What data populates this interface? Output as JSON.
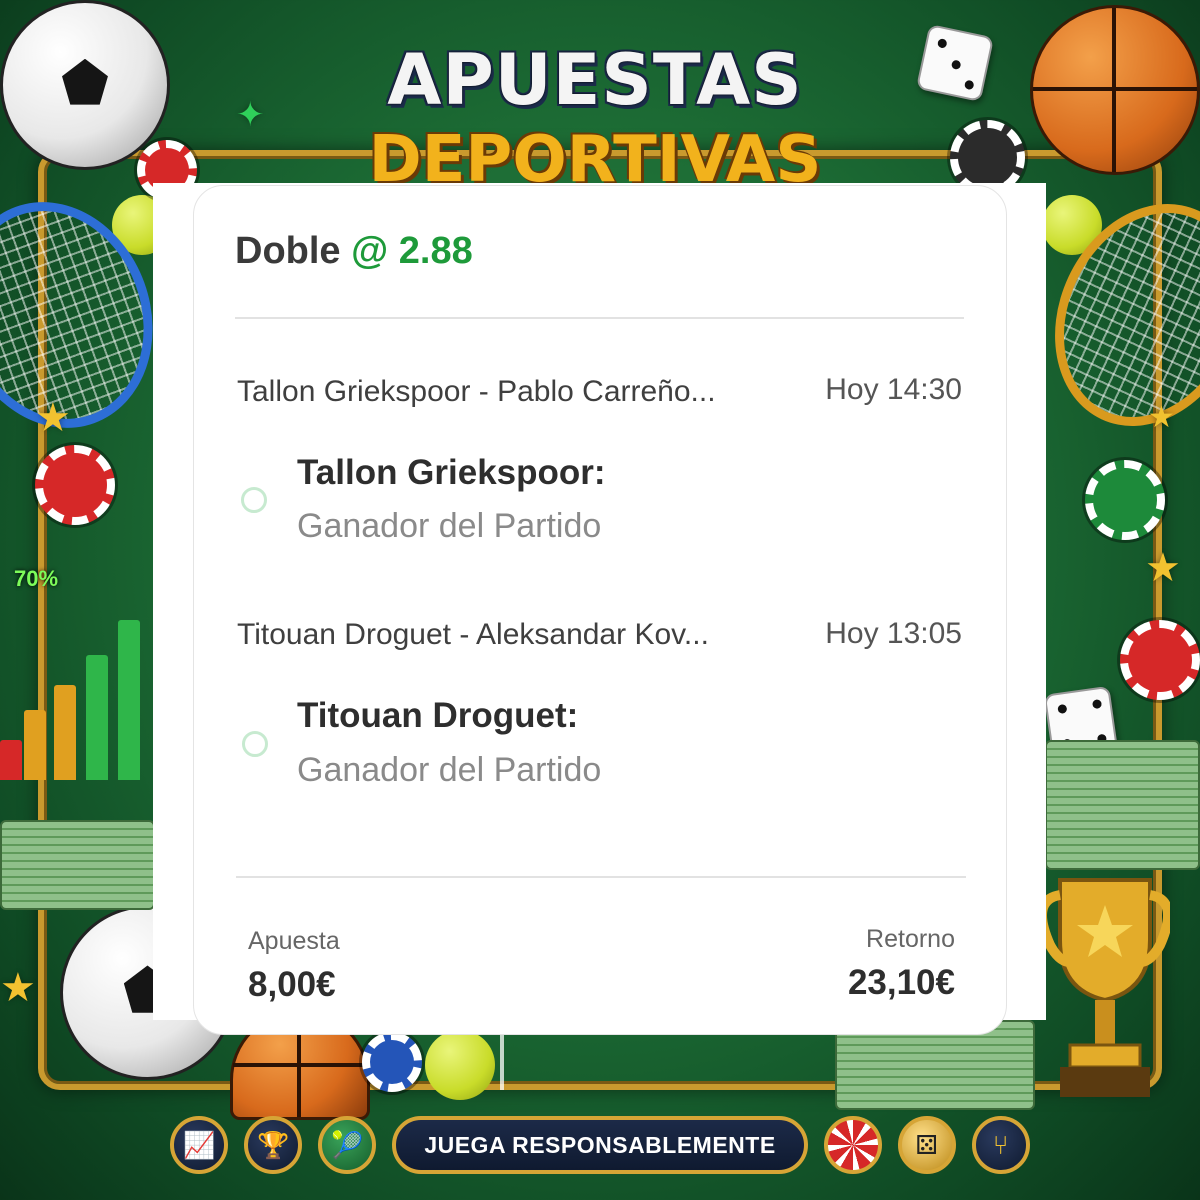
{
  "banner": {
    "line1": "APUESTAS",
    "line2": "DEPORTIVAS",
    "chart_percent": "70%"
  },
  "bet": {
    "type_label": "Doble",
    "at_symbol": "@",
    "odds": "2.88",
    "selections": [
      {
        "event": "Tallon Griekspoor - Pablo Carreño...",
        "time": "Hoy 14:30",
        "pick": "Tallon Griekspoor:",
        "market": "Ganador del Partido"
      },
      {
        "event": "Titouan Droguet - Aleksandar Kov...",
        "time": "Hoy 13:05",
        "pick": "Titouan Droguet:",
        "market": "Ganador del Partido"
      }
    ],
    "stake_label": "Apuesta",
    "stake_value": "8,00€",
    "return_label": "Retorno",
    "return_value": "23,10€"
  },
  "footer": {
    "responsible_label": "JUEGA RESPONSABLEMENTE",
    "icons": [
      "chart-icon",
      "trophy-icon",
      "tennis-icon",
      "poker-chip-icon",
      "dice-icon",
      "share-icon"
    ]
  },
  "colors": {
    "odds_green": "#1e9a3a",
    "background_green": "#1c6b34",
    "gold_accent": "#d6a536"
  }
}
